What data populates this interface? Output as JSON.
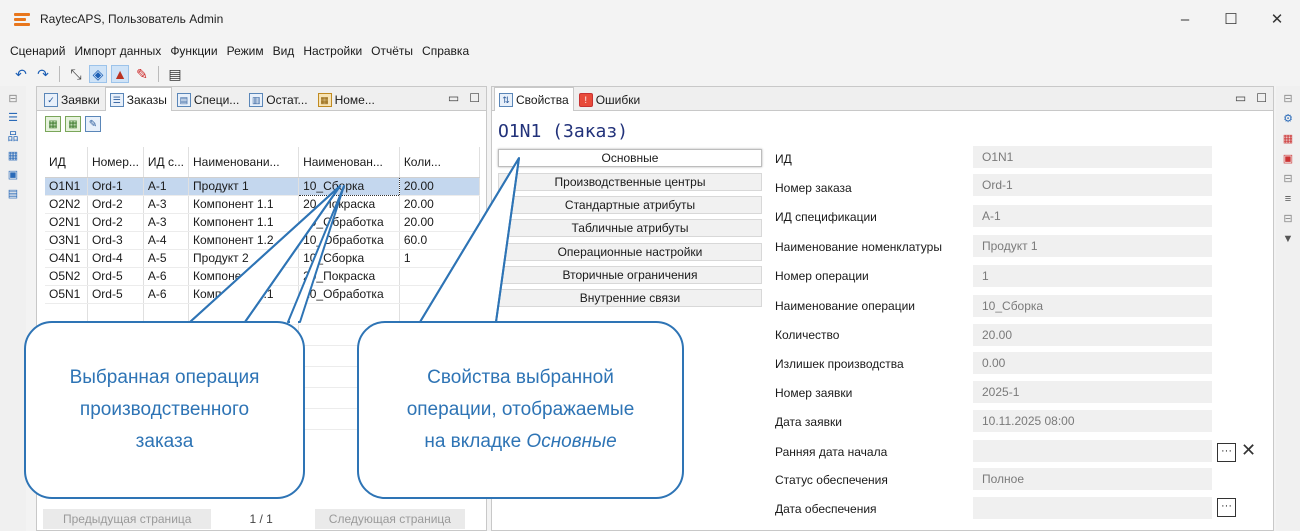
{
  "window": {
    "title": "RaytecAPS, Пользователь Admin",
    "controls": [
      "–",
      "☐",
      "✕"
    ]
  },
  "menu": [
    "Сценарий",
    "Импорт данных",
    "Функции",
    "Режим",
    "Вид",
    "Настройки",
    "Отчёты",
    "Справка"
  ],
  "left_panel": {
    "tabs": [
      "Заявки",
      "Заказы",
      "Специ...",
      "Остат...",
      "Номе..."
    ],
    "active_tab": 1,
    "columns": [
      "ИД",
      "Номер...",
      "ИД с...",
      "Наименовани...",
      "Наименован...",
      "Коли..."
    ],
    "rows": [
      [
        "O1N1",
        "Ord-1",
        "A-1",
        "Продукт 1",
        "10_Сборка",
        "20.00"
      ],
      [
        "O2N2",
        "Ord-2",
        "A-3",
        "Компонент 1.1",
        "20_Покраска",
        "20.00"
      ],
      [
        "O2N1",
        "Ord-2",
        "A-3",
        "Компонент 1.1",
        "10_Обработка",
        "20.00"
      ],
      [
        "O3N1",
        "Ord-3",
        "A-4",
        "Компонент 1.2",
        "10_Обработка",
        "60.0"
      ],
      [
        "O4N1",
        "Ord-4",
        "A-5",
        "Продукт 2",
        "10_Сборка",
        "1"
      ],
      [
        "O5N2",
        "Ord-5",
        "A-6",
        "Компонент 2.1",
        "20_Покраска",
        ""
      ],
      [
        "O5N1",
        "Ord-5",
        "A-6",
        "Компонент 2.1",
        "10_Обработка",
        ""
      ]
    ],
    "selected_row": 0,
    "pager": {
      "prev": "Предыдущая страница",
      "page": "1 / 1",
      "next": "Следующая страница"
    }
  },
  "right_panel": {
    "tabs": [
      "Свойства",
      "Ошибки"
    ],
    "active_tab": 0,
    "object_title": "O1N1 (Заказ)",
    "categories": [
      "Основные",
      "Производственные центры",
      "Стандартные атрибуты",
      "Табличные атрибуты",
      "Операционные настройки",
      "Вторичные ограничения",
      "Внутренние связи"
    ],
    "active_category": 0,
    "properties": [
      {
        "label": "ИД",
        "value": "O1N1"
      },
      {
        "label": "Номер заказа",
        "value": "Ord-1"
      },
      {
        "label": "ИД спецификации",
        "value": "A-1"
      },
      {
        "label": "Наименование номенклатуры",
        "value": "Продукт 1"
      },
      {
        "label": "Номер операции",
        "value": "1"
      },
      {
        "label": "Наименование операции",
        "value": "10_Сборка"
      },
      {
        "label": "Количество",
        "value": "20.00"
      },
      {
        "label": "Излишек производства",
        "value": "0.00"
      },
      {
        "label": "Номер заявки",
        "value": "2025-1"
      },
      {
        "label": "Дата заявки",
        "value": "10.11.2025 08:00"
      },
      {
        "label": "Ранняя дата начала",
        "value": ""
      },
      {
        "label": "Статус обеспечения",
        "value": "Полное"
      },
      {
        "label": "Дата обеспечения",
        "value": ""
      }
    ],
    "ellipsis": "···",
    "clear": "✕"
  },
  "callouts": {
    "left": "Выбранная операция производственного заказа",
    "right_before": "Свойства выбранной операции, отображаемые на вкладке",
    "right_em": "Основные"
  },
  "colors": {
    "accent": "#2e74b5",
    "selection": "#c4d7ee",
    "title": "#22327a"
  }
}
